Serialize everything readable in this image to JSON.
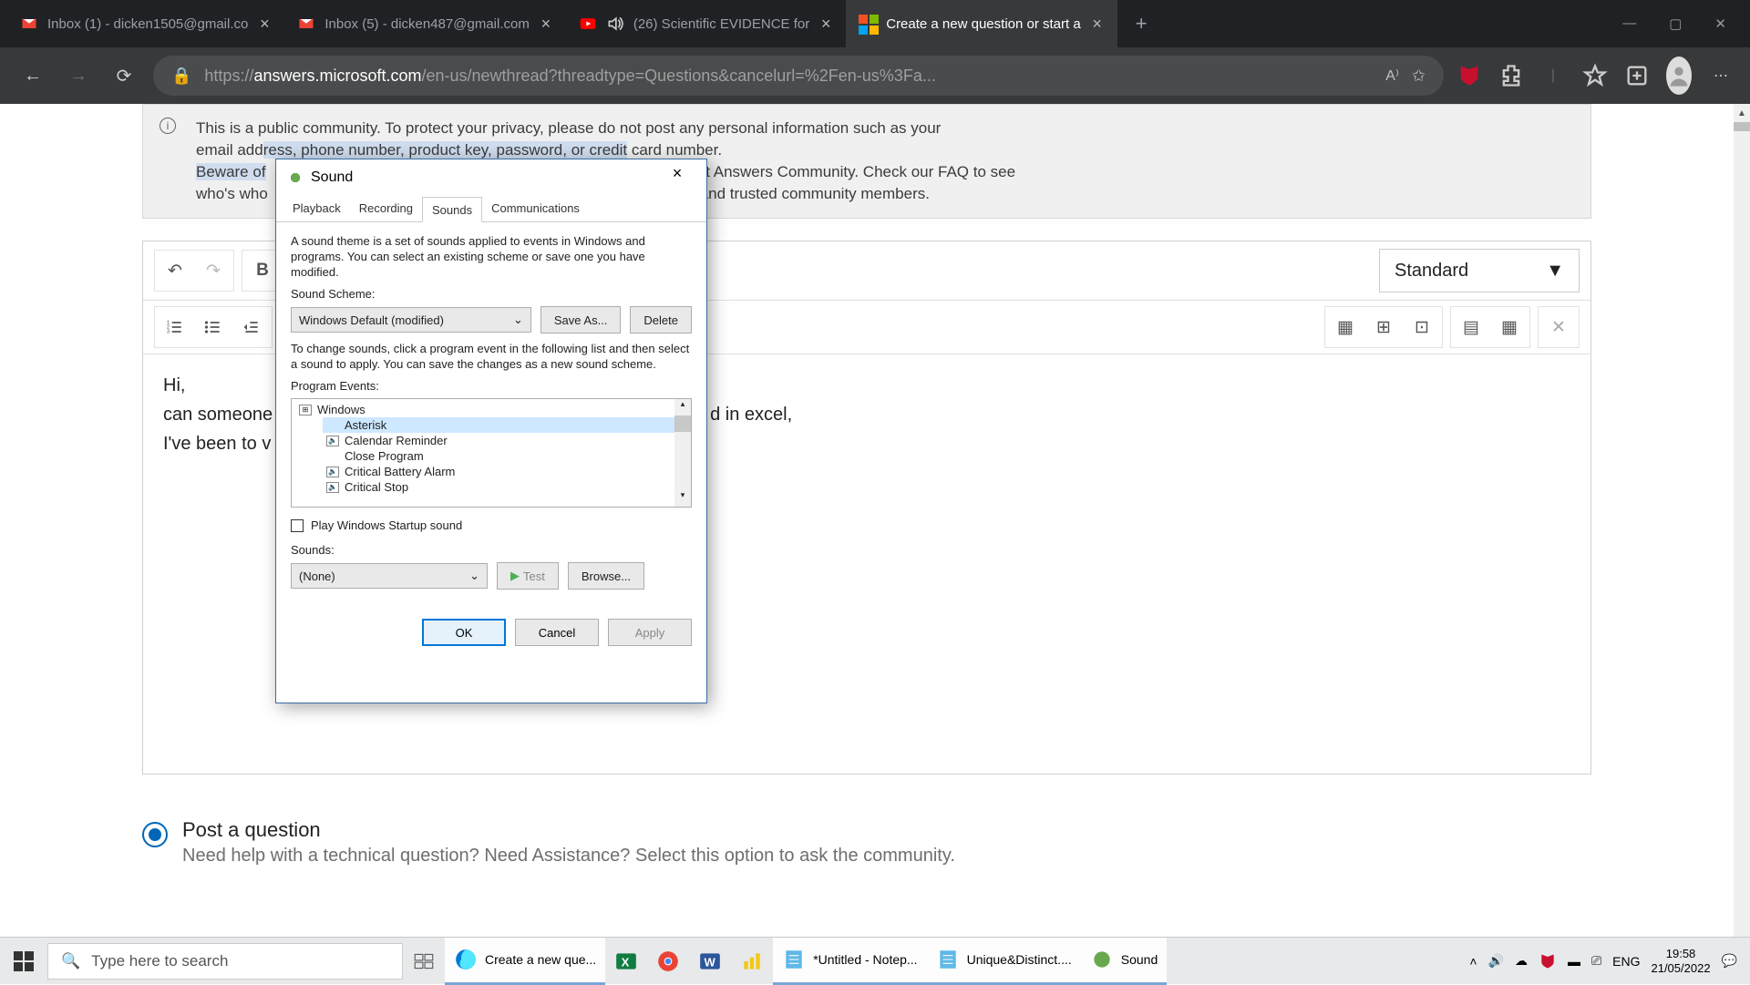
{
  "browser": {
    "tabs": [
      {
        "label": "Inbox (1) - dicken1505@gmail.co",
        "icon": "gmail"
      },
      {
        "label": "Inbox (5) - dicken487@gmail.com",
        "icon": "gmail"
      },
      {
        "label": "(26) Scientific EVIDENCE for",
        "icon": "youtube"
      },
      {
        "label": "Create a new question or start a",
        "icon": "microsoft",
        "active": true
      }
    ],
    "url_proto": "https://",
    "url_domain": "answers.microsoft.com",
    "url_path": "/en-us/newthread?threadtype=Questions&cancelurl=%2Fen-us%3Fa..."
  },
  "notice": {
    "line1a": "This is a public community. To protect your privacy, please do not post any personal information such as your ",
    "line1b": "email add",
    "line1c": "ress, phone number, product key, password, or credit",
    "line1d": " card number.",
    "line2a": "Beware of",
    "line2b": "soft Answers Community.  Check our FAQ to see ",
    "line3a": "who's who",
    "line3b": "ff and trusted community members."
  },
  "editor": {
    "style_select": "Standard",
    "body_l1": "Hi,",
    "body_l2a": "can someone",
    "body_l2b": "d in excel,",
    "body_l3": "I've been to v"
  },
  "radio": {
    "label": "Post a question",
    "sub": "Need help with a technical question? Need Assistance? Select this option to ask the community."
  },
  "sound_dialog": {
    "title": "Sound",
    "tabs": [
      "Playback",
      "Recording",
      "Sounds",
      "Communications"
    ],
    "active_tab": 2,
    "desc": "A sound theme is a set of sounds applied to events in Windows and programs.  You can select an existing scheme or save one you have modified.",
    "scheme_label": "Sound Scheme:",
    "scheme_value": "Windows Default (modified)",
    "save_as": "Save As...",
    "delete": "Delete",
    "change_desc": "To change sounds, click a program event in the following list and then select a sound to apply.  You can save the changes as a new sound scheme.",
    "events_label": "Program Events:",
    "tree_root": "Windows",
    "tree_items": [
      {
        "label": "Asterisk",
        "sel": true,
        "snd": false
      },
      {
        "label": "Calendar Reminder",
        "snd": true
      },
      {
        "label": "Close Program",
        "snd": false
      },
      {
        "label": "Critical Battery Alarm",
        "snd": true
      },
      {
        "label": "Critical Stop",
        "snd": true
      }
    ],
    "startup_label": "Play Windows Startup sound",
    "sounds_label": "Sounds:",
    "sounds_value": "(None)",
    "test": "Test",
    "browse": "Browse...",
    "ok": "OK",
    "cancel": "Cancel",
    "apply": "Apply"
  },
  "taskbar": {
    "search_placeholder": "Type here to search",
    "items": [
      {
        "label": "Create a new que...",
        "icon": "edge",
        "active": true
      },
      {
        "label": "",
        "icon": "excel"
      },
      {
        "label": "",
        "icon": "chrome"
      },
      {
        "label": "",
        "icon": "word"
      },
      {
        "label": "",
        "icon": "powerbi"
      },
      {
        "label": "*Untitled - Notep...",
        "icon": "notepad",
        "active": true
      },
      {
        "label": "Unique&Distinct....",
        "icon": "notepad",
        "active": true
      },
      {
        "label": "Sound",
        "icon": "speaker",
        "active": true
      }
    ],
    "lang": "ENG",
    "time": "19:58",
    "date": "21/05/2022"
  }
}
